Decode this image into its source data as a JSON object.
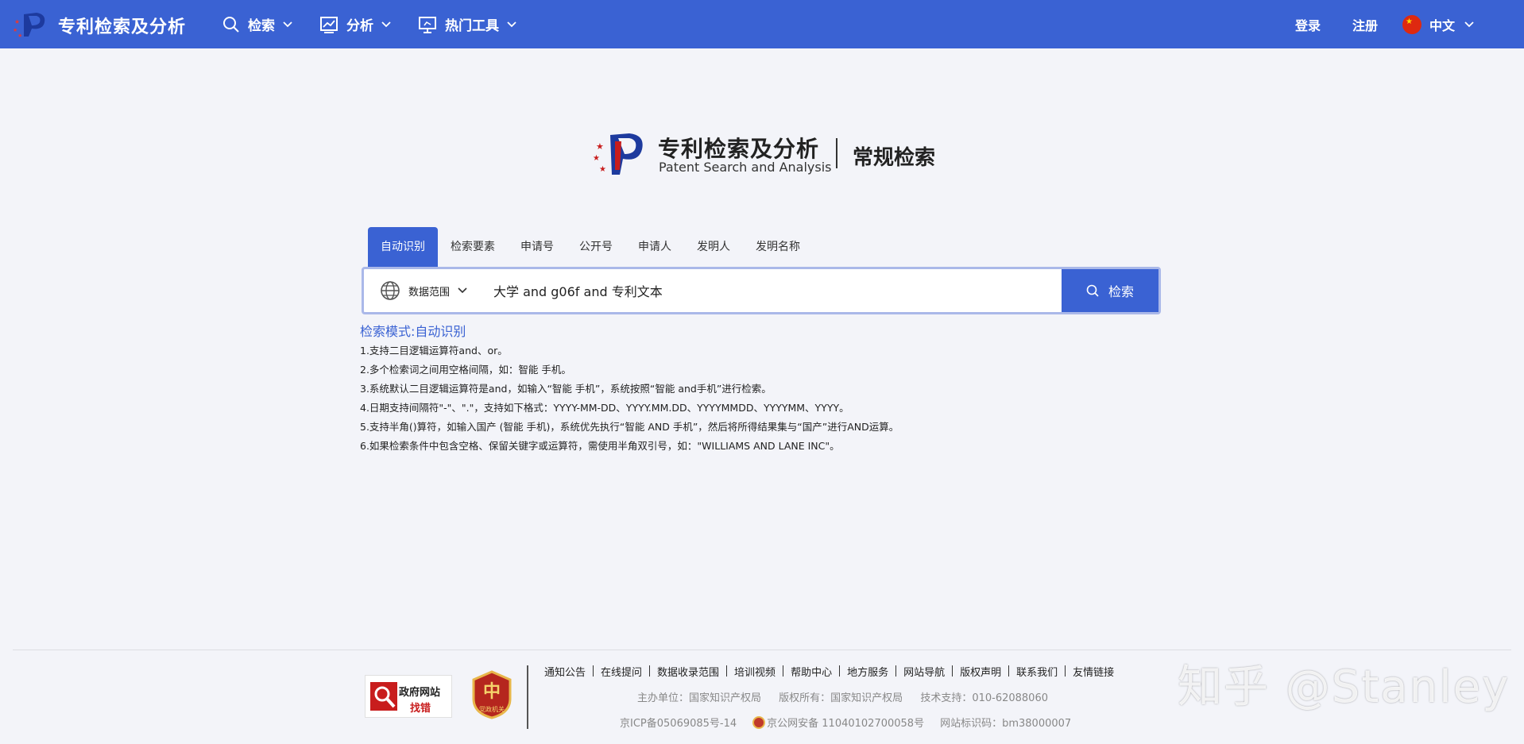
{
  "nav": {
    "brand": "专利检索及分析",
    "menu": [
      {
        "label": "检索",
        "icon": "search-icon"
      },
      {
        "label": "分析",
        "icon": "chart-icon"
      },
      {
        "label": "热门工具",
        "icon": "monitor-icon"
      }
    ],
    "login": "登录",
    "register": "注册",
    "language": "中文"
  },
  "hero": {
    "title_cn": "专利检索及分析",
    "title_en": "Patent Search and Analysis",
    "subtitle": "常规检索"
  },
  "tabs": [
    "自动识别",
    "检索要素",
    "申请号",
    "公开号",
    "申请人",
    "发明人",
    "发明名称"
  ],
  "active_tab": "自动识别",
  "search": {
    "scope_label": "数据范围",
    "query": "大学 and g06f and 专利文本",
    "button_label": "检索"
  },
  "help": {
    "mode_label": "检索模式:",
    "mode_value": "自动识别",
    "lines": [
      "1.支持二目逻辑运算符and、or。",
      "2.多个检索词之间用空格间隔，如：智能 手机。",
      "3.系统默认二目逻辑运算符是and，如输入“智能 手机”，系统按照“智能 and手机”进行检索。",
      "4.日期支持间隔符\"-\"、\".\"，支持如下格式：YYYY-MM-DD、YYYY.MM.DD、YYYYMMDD、YYYYMM、YYYY。",
      "5.支持半角()算符，如输入国产 (智能 手机)，系统优先执行“智能 AND 手机”，然后将所得结果集与“国产”进行AND运算。",
      "6.如果检索条件中包含空格、保留关键字或运算符，需使用半角双引号，如：\"WILLIAMS AND LANE INC\"。"
    ]
  },
  "footer": {
    "gov_badge_line1": "政府网站",
    "gov_badge_line2": "找错",
    "party_badge": "党政机关",
    "links": [
      "通知公告",
      "在线提问",
      "数据收录范围",
      "培训视频",
      "帮助中心",
      "地方服务",
      "网站导航",
      "版权声明",
      "联系我们",
      "友情链接"
    ],
    "sponsor": "主办单位：国家知识产权局",
    "copyright": "版权所有：国家知识产权局",
    "support": "技术支持：010-62088060",
    "icp": "京ICP备05069085号-14",
    "police": "京公网安备 11040102700058号",
    "site_code": "网站标识码：bm38000007"
  },
  "watermark": "知乎 @Stanley",
  "colors": {
    "primary": "#3a62d3",
    "background": "#f3f4f9",
    "accent_red": "#c81d1d"
  }
}
